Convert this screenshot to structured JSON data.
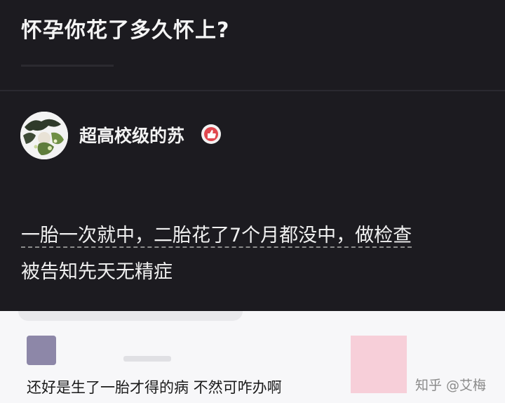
{
  "question": {
    "title": "怀孕你花了多久怀上?"
  },
  "answer": {
    "author_name": "超高校级的苏",
    "body_line1": "一胎一次就中，二胎花了7个月都没中，做检查",
    "body_line2": "被告知先天无精症"
  },
  "comment": {
    "text": "还好是生了一胎才得的病 不然可咋办啊"
  },
  "watermark": {
    "text": "知乎 @艾梅"
  },
  "colors": {
    "background_dark": "#1c1b20",
    "text_light": "#f2f2f2",
    "badge_red": "#e0474e"
  }
}
